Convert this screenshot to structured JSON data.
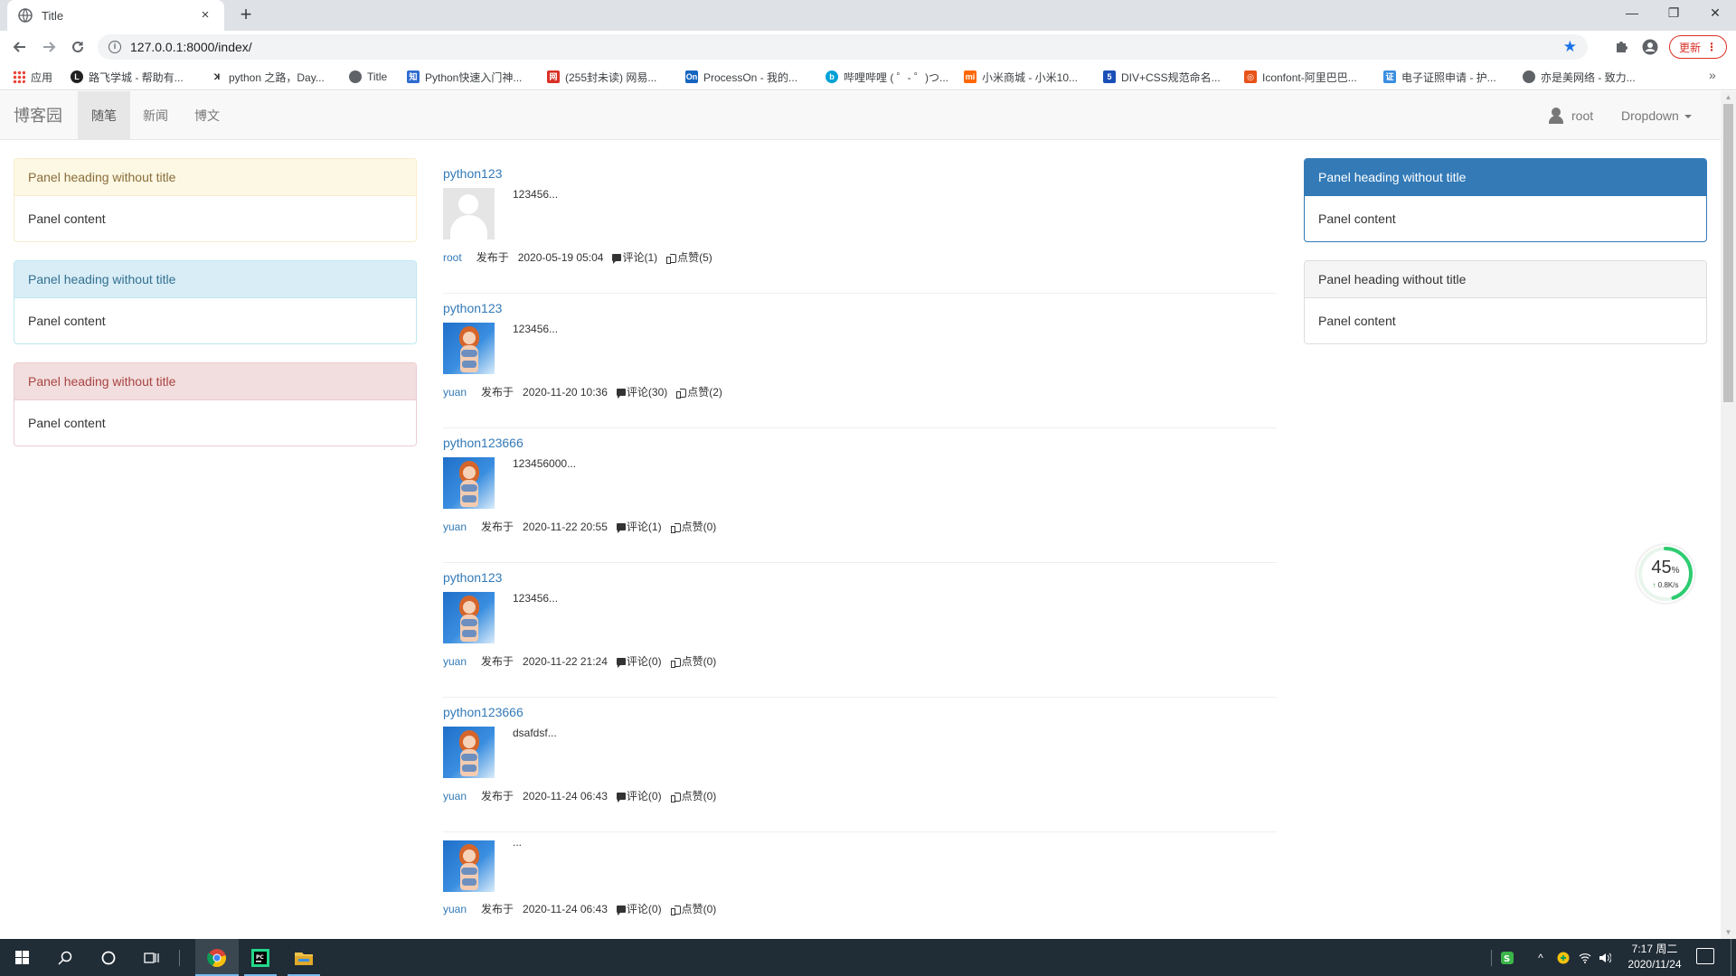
{
  "browser": {
    "tab_title": "Title",
    "tab_close": "×",
    "new_tab": "+",
    "url": "127.0.0.1:8000/index/",
    "update_label": "更新",
    "window_controls": [
      "—",
      "❐",
      "✕"
    ]
  },
  "bookmarks": [
    {
      "label": "应用",
      "icon": "apps-grid-icon"
    },
    {
      "label": "路飞学城 - 帮助有...",
      "icon": "luffy-icon"
    },
    {
      "label": "python 之路，Day...",
      "icon": "python-road-icon"
    },
    {
      "label": "Title",
      "icon": "globe-icon"
    },
    {
      "label": "Python快速入门神...",
      "icon": "python-quickstart-icon"
    },
    {
      "label": "(255封未读) 网易...",
      "icon": "netease-mail-icon"
    },
    {
      "label": "ProcessOn - 我的...",
      "icon": "processon-icon"
    },
    {
      "label": "哔哩哔哩 ( ゜- ゜)つ...",
      "icon": "bilibili-icon"
    },
    {
      "label": "小米商城 - 小米10...",
      "icon": "mi-icon"
    },
    {
      "label": "DIV+CSS规范命名...",
      "icon": "div-css-icon"
    },
    {
      "label": "Iconfont-阿里巴巴...",
      "icon": "iconfont-icon"
    },
    {
      "label": "电子证照申请 - 护...",
      "icon": "e-license-icon"
    },
    {
      "label": "亦是美网络 - 致力...",
      "icon": "yishimei-icon"
    }
  ],
  "site_nav": {
    "brand": "博客园",
    "items": [
      {
        "label": "随笔",
        "active": true
      },
      {
        "label": "新闻",
        "active": false
      },
      {
        "label": "博文",
        "active": false
      }
    ],
    "user": "root",
    "dropdown": "Dropdown"
  },
  "left_panels": [
    {
      "style": "warning",
      "heading": "Panel heading without title",
      "content": "Panel content"
    },
    {
      "style": "info",
      "heading": "Panel heading without title",
      "content": "Panel content"
    },
    {
      "style": "danger",
      "heading": "Panel heading without title",
      "content": "Panel content"
    }
  ],
  "right_panels": [
    {
      "style": "primary",
      "heading": "Panel heading without title",
      "content": "Panel content"
    },
    {
      "style": "default",
      "heading": "Panel heading without title",
      "content": "Panel content"
    }
  ],
  "articles": [
    {
      "title": "python123",
      "summary": "123456...",
      "author": "root",
      "published_label": "发布于",
      "date": "2020-05-19 05:04",
      "comments": "评论(1)",
      "likes": "点赞(5)",
      "avatar": "default-avatar"
    },
    {
      "title": "python123",
      "summary": "123456...",
      "author": "yuan",
      "published_label": "发布于",
      "date": "2020-11-20 10:36",
      "comments": "评论(30)",
      "likes": "点赞(2)",
      "avatar": "anime-avatar"
    },
    {
      "title": "python123666",
      "summary": "123456000...",
      "author": "yuan",
      "published_label": "发布于",
      "date": "2020-11-22 20:55",
      "comments": "评论(1)",
      "likes": "点赞(0)",
      "avatar": "anime-avatar"
    },
    {
      "title": "python123",
      "summary": "123456...",
      "author": "yuan",
      "published_label": "发布于",
      "date": "2020-11-22 21:24",
      "comments": "评论(0)",
      "likes": "点赞(0)",
      "avatar": "anime-avatar"
    },
    {
      "title": "python123666",
      "summary": "dsafdsf...",
      "author": "yuan",
      "published_label": "发布于",
      "date": "2020-11-24 06:43",
      "comments": "评论(0)",
      "likes": "点赞(0)",
      "avatar": "anime-avatar"
    },
    {
      "title": "",
      "summary": "...",
      "author": "yuan",
      "published_label": "发布于",
      "date": "2020-11-24 06:43",
      "comments": "评论(0)",
      "likes": "点赞(0)",
      "avatar": "anime-avatar"
    }
  ],
  "speed_widget": {
    "percent": "45",
    "percent_unit": "%",
    "rate": "0.8K/s",
    "ring_fraction": 0.45,
    "ring_color": "#2ecc71"
  },
  "taskbar": {
    "time": "7:17 周二",
    "date": "2020/11/24"
  },
  "colors": {
    "primary": "#337ab7",
    "nav_bg": "#f8f8f8",
    "taskbar_bg": "#202c36"
  }
}
